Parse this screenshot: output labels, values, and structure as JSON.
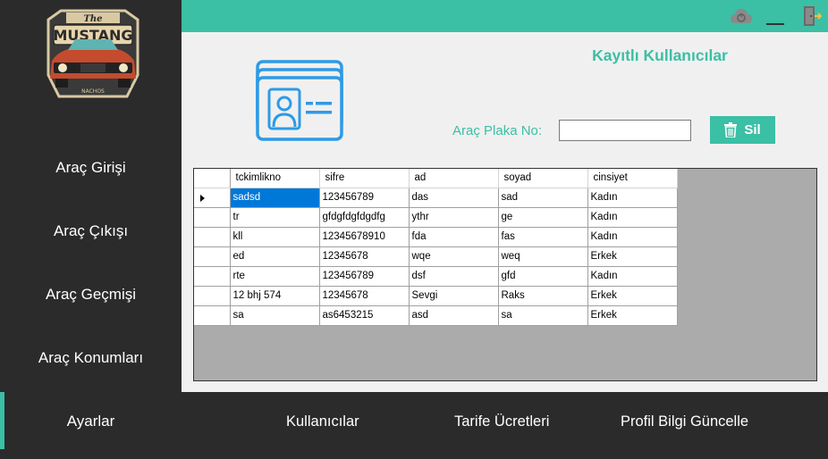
{
  "colors": {
    "accent": "#3bbfa5",
    "sidebar": "#2b2b2b",
    "content_bg": "#f0f0f0",
    "selection": "#0078d7"
  },
  "logo": {
    "top_text": "The",
    "main_text": "MUSTANG",
    "sub_text": "NACHOS"
  },
  "sidebar": {
    "items": [
      {
        "label": "Araç Girişi"
      },
      {
        "label": "Araç Çıkışı"
      },
      {
        "label": "Araç Geçmişi"
      },
      {
        "label": "Araç Konumları"
      },
      {
        "label": "Ayarlar",
        "active": true
      }
    ]
  },
  "topbar": {
    "icons": [
      "cloud-power-icon",
      "minimize-icon",
      "exit-door-icon"
    ]
  },
  "main": {
    "title": "Kayıtlı Kullanıcılar",
    "plate_label": "Araç Plaka No:",
    "plate_value": "",
    "delete_label": "Sil"
  },
  "table": {
    "columns": [
      "tckimlikno",
      "sifre",
      "ad",
      "soyad",
      "cinsiyet"
    ],
    "rows": [
      [
        "sadsd",
        "123456789",
        "das",
        "sad",
        "Kadın"
      ],
      [
        "tr",
        "gfdgfdgfdgdfg",
        "ythr",
        "ge",
        "Kadın"
      ],
      [
        "kll",
        "12345678910",
        "fda",
        "fas",
        "Kadın"
      ],
      [
        "ed",
        "12345678",
        "wqe",
        "weq",
        "Erkek"
      ],
      [
        "rte",
        "123456789",
        "dsf",
        "gfd",
        "Kadın"
      ],
      [
        "12 bhj 574",
        "12345678",
        "Sevgi",
        "Raks",
        "Erkek"
      ],
      [
        "sa",
        "as6453215",
        "asd",
        "sa",
        "Erkek"
      ]
    ],
    "selected_row": 0
  },
  "bottom_nav": {
    "items": [
      {
        "label": "Kullanıcılar"
      },
      {
        "label": "Tarife Ücretleri"
      },
      {
        "label": "Profil Bilgi Güncelle"
      }
    ]
  }
}
